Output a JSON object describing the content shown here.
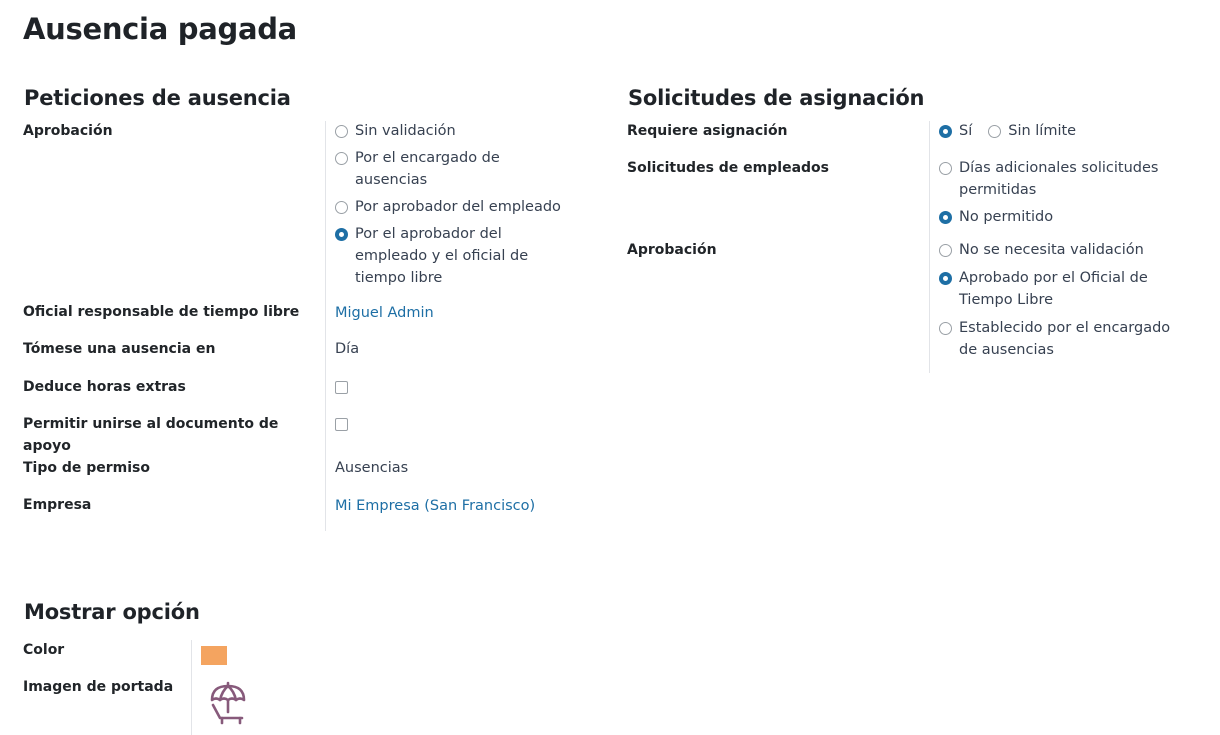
{
  "page_title": "Ausencia pagada",
  "left": {
    "title": "Peticiones de ausencia",
    "approval_label": "Aprobación",
    "approval_options": [
      {
        "label": "Sin validación",
        "selected": false
      },
      {
        "label": "Por el encargado de ausencias",
        "selected": false
      },
      {
        "label": "Por aprobador del empleado",
        "selected": false
      },
      {
        "label": "Por el aprobador del empleado y el oficial de tiempo libre",
        "selected": true
      }
    ],
    "officer_label": "Oficial responsable de tiempo libre",
    "officer_value": "Miguel Admin",
    "take_label": "Tómese una ausencia en",
    "take_value": "Día",
    "deduct_label": "Deduce horas extras",
    "deduct_checked": false,
    "attach_label": "Permitir unirse al documento de apoyo",
    "attach_checked": false,
    "type_label": "Tipo de permiso",
    "type_value": "Ausencias",
    "company_label": "Empresa",
    "company_value": "Mi Empresa (San Francisco)"
  },
  "right": {
    "title": "Solicitudes de asignación",
    "requires_label": "Requiere asignación",
    "requires_options": [
      {
        "label": "Sí",
        "selected": true
      },
      {
        "label": "Sin límite",
        "selected": false
      }
    ],
    "employee_requests_label": "Solicitudes de empleados",
    "employee_requests_options": [
      {
        "label": "Días adicionales solicitudes permitidas",
        "selected": false
      },
      {
        "label": "No permitido",
        "selected": true
      }
    ],
    "approval_label": "Aprobación",
    "approval_options": [
      {
        "label": "No se necesita validación",
        "selected": false
      },
      {
        "label": "Aprobado por el Oficial de Tiempo Libre",
        "selected": true
      },
      {
        "label": "Establecido por el encargado de ausencias",
        "selected": false
      }
    ]
  },
  "display": {
    "title": "Mostrar opción",
    "color_label": "Color",
    "color_value": "#f4a460",
    "cover_label": "Imagen de portada",
    "cover_icon": "beach-umbrella-icon",
    "icon_color": "#875a7b"
  }
}
